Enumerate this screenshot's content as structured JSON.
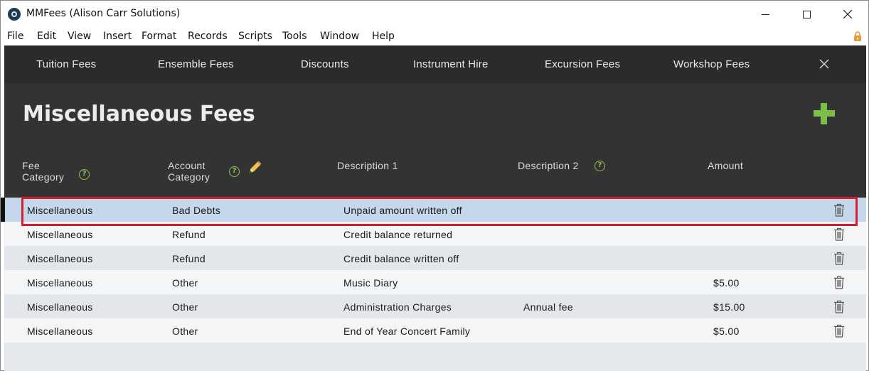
{
  "window": {
    "title": "MMFees (Alison Carr Solutions)"
  },
  "menu": [
    "File",
    "Edit",
    "View",
    "Insert",
    "Format",
    "Records",
    "Scripts",
    "Tools",
    "Window",
    "Help"
  ],
  "nav_tabs": [
    "Tuition Fees",
    "Ensemble Fees",
    "Discounts",
    "Instrument Hire",
    "Excursion Fees",
    "Workshop Fees"
  ],
  "page": {
    "title": "Miscellaneous Fees"
  },
  "columns": {
    "fee_category": "Fee\nCategory",
    "account_category": "Account\nCategory",
    "description1": "Description 1",
    "description2": "Description 2",
    "amount": "Amount"
  },
  "help_glyph": "?",
  "rows": [
    {
      "fee_category": "Miscellaneous",
      "account_category": "Bad Debts",
      "description1": "Unpaid amount written off",
      "description2": "",
      "amount": ""
    },
    {
      "fee_category": "Miscellaneous",
      "account_category": "Refund",
      "description1": "Credit balance returned",
      "description2": "",
      "amount": ""
    },
    {
      "fee_category": "Miscellaneous",
      "account_category": "Refund",
      "description1": "Credit balance written off",
      "description2": "",
      "amount": ""
    },
    {
      "fee_category": "Miscellaneous",
      "account_category": "Other",
      "description1": "Music Diary",
      "description2": "",
      "amount": "$5.00"
    },
    {
      "fee_category": "Miscellaneous",
      "account_category": "Other",
      "description1": "Administration Charges",
      "description2": "Annual fee",
      "amount": "$15.00"
    },
    {
      "fee_category": "Miscellaneous",
      "account_category": "Other",
      "description1": "End of Year Concert Family",
      "description2": "",
      "amount": "$5.00"
    }
  ],
  "colors": {
    "nav_background": "#2b2b2b",
    "header_background": "#333333",
    "accent_green": "#7bbf4a",
    "selected_row": "#c5d7ea",
    "highlight_red": "#d2202f"
  }
}
